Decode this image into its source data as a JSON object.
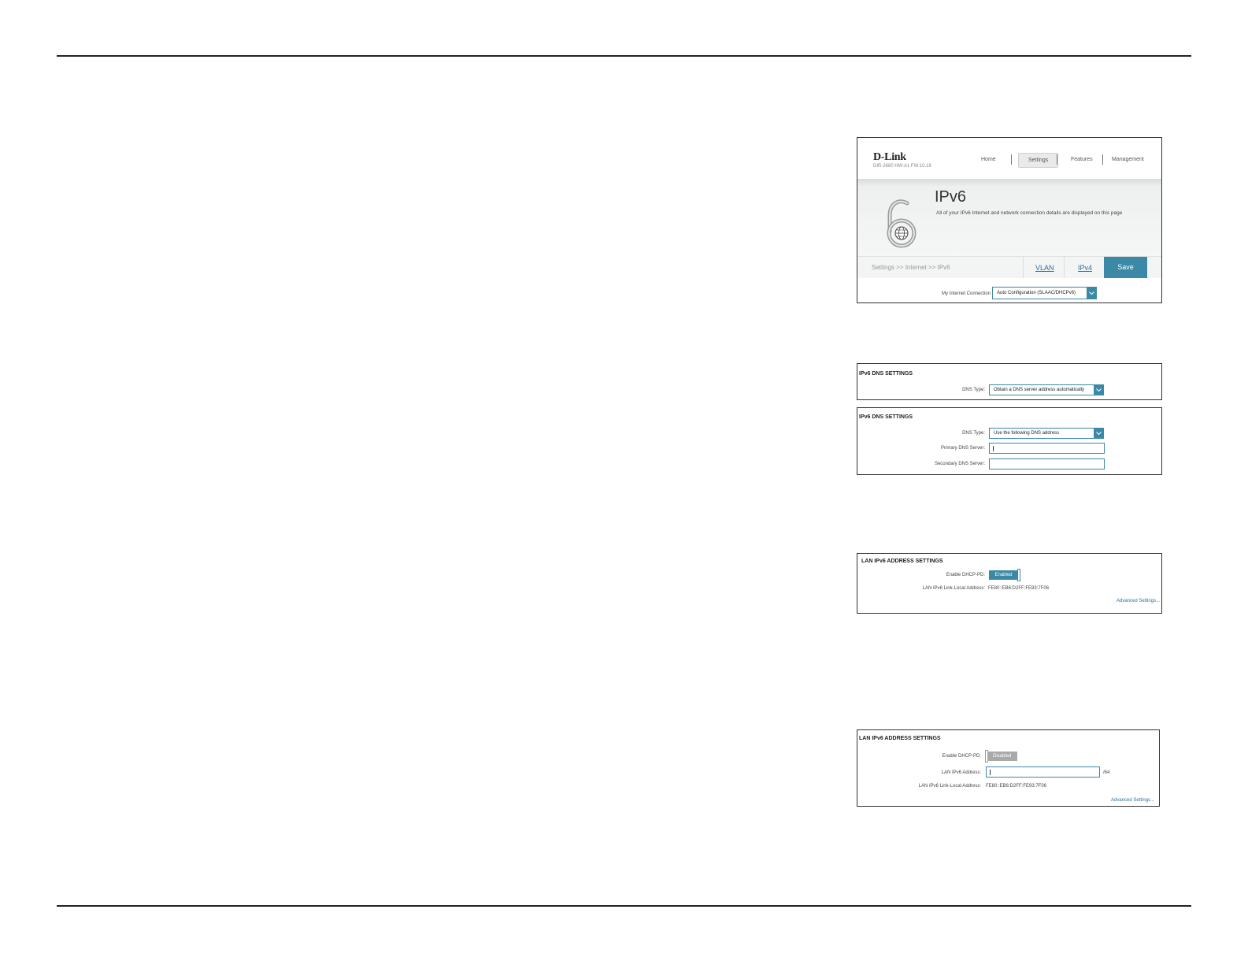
{
  "router_page": {
    "brand": "D-Link",
    "model": "DIR-2680 HW:A1 FW:10.16",
    "nav": [
      "Home",
      "Settings",
      "Features",
      "Management"
    ],
    "active_nav": "Settings",
    "title": "IPv6",
    "description": "All of your IPv6 Internet and network connection details are displayed on this page",
    "breadcrumb": "Settings >> Internet >> IPv6",
    "tabs": [
      "VLAN",
      "IPv4"
    ],
    "save_label": "Save",
    "connection_label": "My Internet Connection is:",
    "connection_value": "Auto Configuration (SLAAC/DHCPv6)",
    "icon": "ipv6-lock-globe-icon"
  },
  "dns_auto": {
    "title": "IPv6 DNS SETTINGS",
    "dns_type_label": "DNS Type:",
    "dns_type_value": "Obtain a DNS server address automatically"
  },
  "dns_manual": {
    "title": "IPv6 DNS SETTINGS",
    "dns_type_label": "DNS Type:",
    "dns_type_value": "Use the following DNS address",
    "primary_label": "Primary DNS Server:",
    "secondary_label": "Secondary DNS Server:"
  },
  "lan_enabled": {
    "title": "LAN IPv6 ADDRESS SETTINGS",
    "dhcp_pd_label": "Enable DHCP-PD:",
    "dhcp_pd_value": "Enabled",
    "link_local_label": "LAN IPv6 Link-Local Address:",
    "link_local_value": "FE80::EB6:D2FF:FE93:7F06",
    "advanced_link": "Advanced Settings..."
  },
  "lan_disabled": {
    "title": "LAN IPv6 ADDRESS SETTINGS",
    "dhcp_pd_label": "Enable DHCP-PD:",
    "dhcp_pd_value": "Disabled",
    "lan_address_label": "LAN IPv6 Address:",
    "prefix_suffix": "/64",
    "link_local_label": "LAN IPv6 Link-Local Address:",
    "link_local_value": "FE80::EB6:D2FF:FE93:7F06",
    "advanced_link": "Advanced Settings..."
  },
  "colors": {
    "accent": "#3b89a6",
    "link": "#2b6f9e",
    "disabled": "#a9a9a9",
    "rule": "#222222"
  }
}
